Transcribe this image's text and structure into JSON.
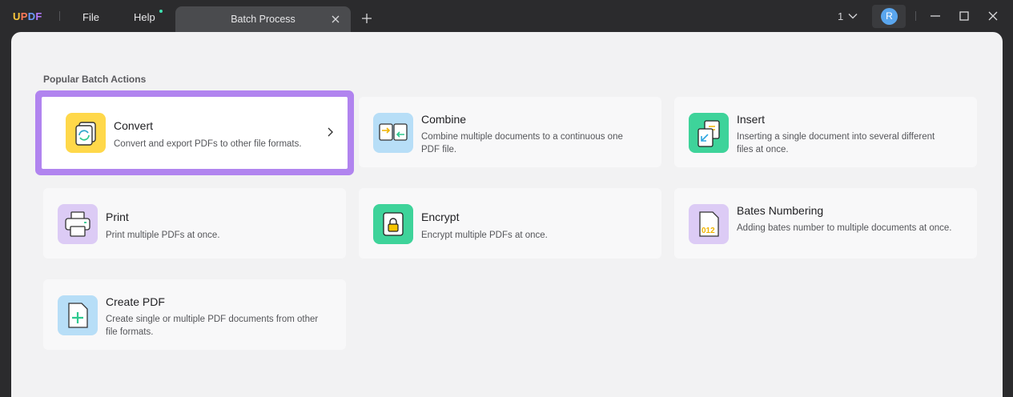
{
  "app": {
    "logo": {
      "u": "U",
      "p": "P",
      "d": "D",
      "f": "F"
    },
    "menu": {
      "file": "File",
      "help": "Help"
    },
    "tab_title": "Batch Process",
    "page_count": "1",
    "avatar_letter": "R"
  },
  "main": {
    "section_title": "Popular Batch Actions",
    "cards": [
      {
        "title": "Convert",
        "desc": "Convert and export PDFs to other file formats.",
        "icon": "convert-icon",
        "color": "#ffd84a"
      },
      {
        "title": "Combine",
        "desc": "Combine multiple documents to a continuous one PDF file.",
        "icon": "combine-icon",
        "color": "#b7def7"
      },
      {
        "title": "Insert",
        "desc": "Inserting a single document into several different files at once.",
        "icon": "insert-icon",
        "color": "#3ed39a"
      },
      {
        "title": "Print",
        "desc": "Print multiple PDFs at once.",
        "icon": "print-icon",
        "color": "#dccbf5"
      },
      {
        "title": "Encrypt",
        "desc": "Encrypt multiple PDFs at once.",
        "icon": "encrypt-icon",
        "color": "#3ed39a"
      },
      {
        "title": "Bates Numbering",
        "desc": "Adding bates number to multiple documents at once.",
        "icon": "bates-numbering-icon",
        "color": "#dccbf5",
        "icon_text": "012"
      },
      {
        "title": "Create PDF",
        "desc": "Create single or multiple PDF documents from other file formats.",
        "icon": "create-pdf-icon",
        "color": "#b7def7"
      }
    ]
  },
  "colors": {
    "selection": "#b184ef",
    "accent_green": "#3ed39a"
  }
}
